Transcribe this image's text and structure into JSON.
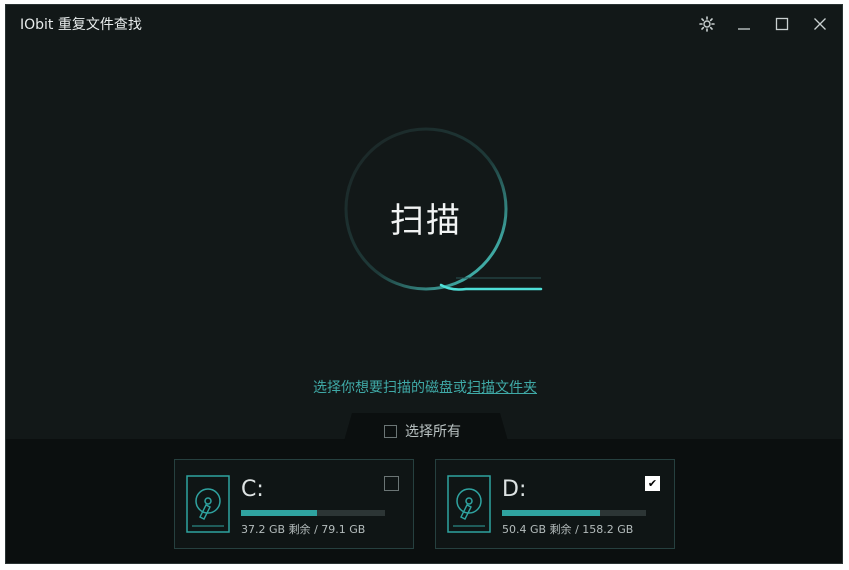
{
  "window": {
    "title": "IObit 重复文件查找"
  },
  "titlebar": {
    "icons": [
      "gear-icon",
      "minimize-icon",
      "maximize-icon",
      "close-icon"
    ]
  },
  "scan": {
    "label": "扫描"
  },
  "hint": {
    "prefix": "选择你想要扫描的磁盘或",
    "link": "扫描文件夹"
  },
  "select_all": {
    "label": "选择所有",
    "checked": false
  },
  "drives": [
    {
      "letter": "C:",
      "free": "37.2 GB",
      "free_word": "剩余",
      "separator": "/",
      "total": "79.1 GB",
      "used_fraction": 0.53,
      "checked": false
    },
    {
      "letter": "D:",
      "free": "50.4 GB",
      "free_word": "剩余",
      "separator": "/",
      "total": "158.2 GB",
      "used_fraction": 0.68,
      "checked": true
    }
  ],
  "colors": {
    "accent": "#3fcfc8",
    "link": "#3fa9a6",
    "background": "#121818",
    "bar": "#2fa3a0"
  }
}
